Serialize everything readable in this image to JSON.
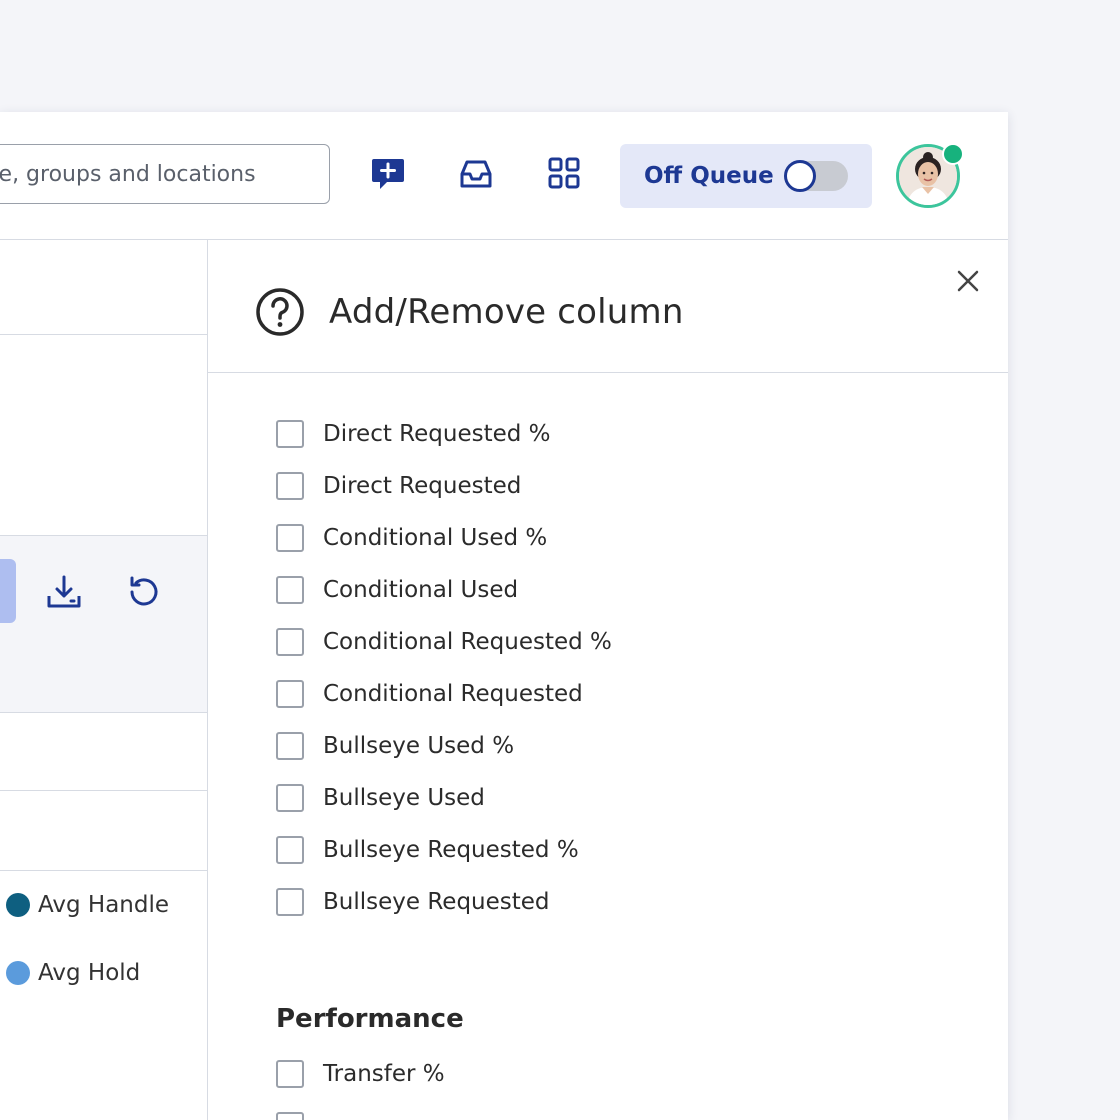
{
  "topbar": {
    "search_placeholder": "people, groups and locations",
    "search_visible_text": "ople, groups and locations",
    "icons": [
      "new-conversation-icon",
      "inbox-icon",
      "apps-grid-icon"
    ],
    "queue_label": "Off Queue",
    "queue_on": false,
    "presence_color": "#17b27d"
  },
  "left_page": {
    "toolbar_icons": [
      "download-icon",
      "reset-icon"
    ],
    "legend": [
      {
        "label": "Avg Handle",
        "color": "#0e5f80"
      },
      {
        "label": "Avg Hold",
        "color": "#5b9bdc"
      }
    ]
  },
  "panel": {
    "title": "Add/Remove column",
    "columns": [
      {
        "label": "Direct Requested %",
        "checked": false
      },
      {
        "label": "Direct Requested",
        "checked": false
      },
      {
        "label": "Conditional Used %",
        "checked": false
      },
      {
        "label": "Conditional Used",
        "checked": false
      },
      {
        "label": "Conditional Requested %",
        "checked": false
      },
      {
        "label": "Conditional Requested",
        "checked": false
      },
      {
        "label": "Bullseye Used %",
        "checked": false
      },
      {
        "label": "Bullseye Used",
        "checked": false
      },
      {
        "label": "Bullseye Requested %",
        "checked": false
      },
      {
        "label": "Bullseye Requested",
        "checked": false
      }
    ],
    "section_title": "Performance",
    "performance_columns": [
      {
        "label": "Transfer %",
        "checked": false
      },
      {
        "label": "",
        "checked": false
      }
    ]
  },
  "colors": {
    "accent": "#1d3893",
    "queue_bg": "#e4e8f8",
    "avatar_ring": "#3cc59c"
  }
}
